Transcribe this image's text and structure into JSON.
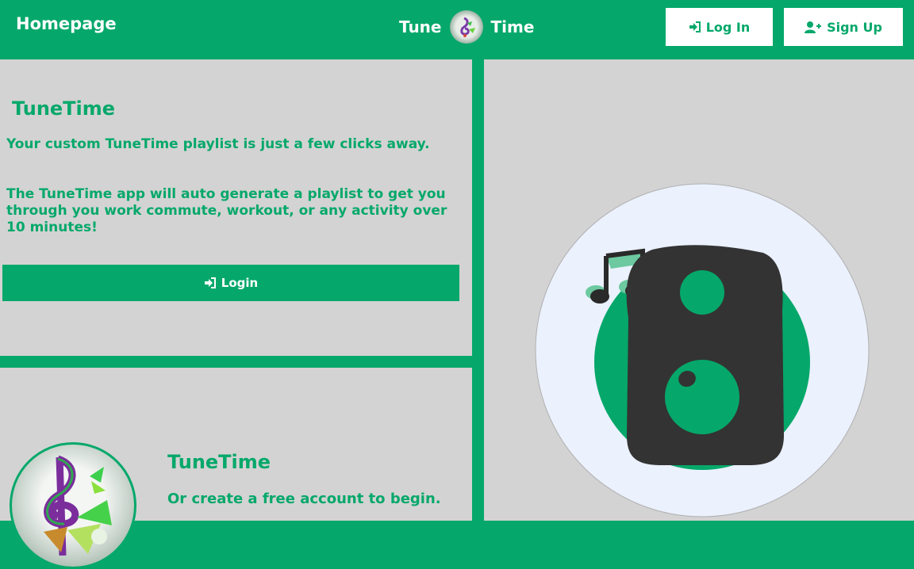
{
  "nav": {
    "home_label": "Homepage",
    "brand_left": "Tune",
    "brand_right": "Time",
    "login_label": "Log In",
    "signup_label": "Sign Up",
    "login_icon": "sign-in-icon",
    "signup_icon": "user-plus-icon"
  },
  "intro": {
    "title": "TuneTime",
    "line1": "Your custom TuneTime playlist is just a few clicks away.",
    "line2": "The TuneTime app will auto generate a playlist to get you through you work commute, workout, or any activity over 10 minutes!",
    "button_label": "Login",
    "button_icon": "sign-in-icon"
  },
  "signup_card": {
    "title": "TuneTime",
    "text": "Or create a free account to begin."
  },
  "colors": {
    "brand": "#05a86a",
    "panel": "#d3d3d3",
    "speaker": "#333333"
  }
}
